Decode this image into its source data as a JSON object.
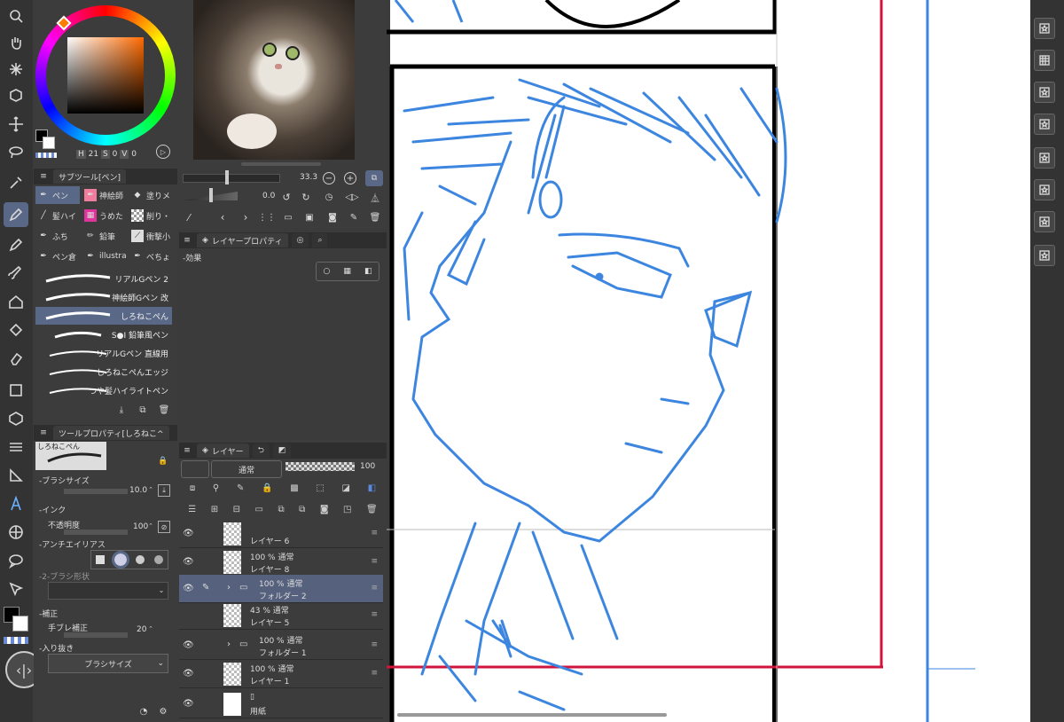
{
  "color_panel": {
    "h_label": "H",
    "h_value": "21",
    "s_label": "S",
    "s_value": "0",
    "v_label": "V",
    "v_value": "0"
  },
  "sub_tool": {
    "tab_label": "サブツール[ペン]",
    "items": [
      {
        "label": "ペン"
      },
      {
        "label": "神絵師"
      },
      {
        "label": "塗りメ"
      },
      {
        "label": "髪ハイ"
      },
      {
        "label": "うめた"
      },
      {
        "label": "削り・"
      },
      {
        "label": "ふち"
      },
      {
        "label": "鉛筆"
      },
      {
        "label": "衝撃小"
      },
      {
        "label": "ペン倉"
      },
      {
        "label": "illustra"
      },
      {
        "label": "べちょ"
      }
    ],
    "brushes": [
      {
        "label": "リアルGペン 2"
      },
      {
        "label": "神絵師Gペン 改"
      },
      {
        "label": "しろねこぺん"
      },
      {
        "label": "S●I 鉛筆風ペン"
      },
      {
        "label": "リアルGペン 直線用"
      },
      {
        "label": "しろねこぺんエッジ"
      },
      {
        "label": "つや髪ハイライトペン"
      }
    ]
  },
  "navigator": {
    "zoom": "33.3",
    "rotation": "0.0"
  },
  "layer_property": {
    "tab_label": "レイヤープロパティ",
    "effect_label": "-効果"
  },
  "tool_property": {
    "tab_label": "ツールプロパティ[しろねこ^",
    "preview_label": "しろねこぺん",
    "brush_size_label": "-ブラシサイズ",
    "brush_size_value": "10.0",
    "ink_label": "-インク",
    "opacity_label": "不透明度",
    "opacity_value": "100",
    "antialias_label": "-アンチエイリアス",
    "brush_shape_label": "-2-ブラシ形状",
    "correction_label": "-補正",
    "stabilization_label": "手ブレ補正",
    "stabilization_value": "20",
    "taper_label": "-入り抜き",
    "taper_select": "ブラシサイズ"
  },
  "layers": {
    "tab_label": "レイヤー",
    "blend_mode": "通常",
    "opacity_value": "100",
    "items": [
      {
        "line1": "",
        "line2": "レイヤー 6"
      },
      {
        "line1": "100 % 通常",
        "line2": "レイヤー 8"
      },
      {
        "line1": "100 % 通常",
        "line2": "フォルダー 2"
      },
      {
        "line1": "43 % 通常",
        "line2": "レイヤー 5"
      },
      {
        "line1": "100 % 通常",
        "line2": "フォルダー 1"
      },
      {
        "line1": "100 % 通常",
        "line2": "レイヤー 1"
      },
      {
        "line1": "",
        "line2": "用紙"
      }
    ]
  },
  "colors": {
    "accent": "#5a6887",
    "sketch_blue": "#3d86e0",
    "guide_red": "#d0143c",
    "panel": "#3c3c3c"
  }
}
